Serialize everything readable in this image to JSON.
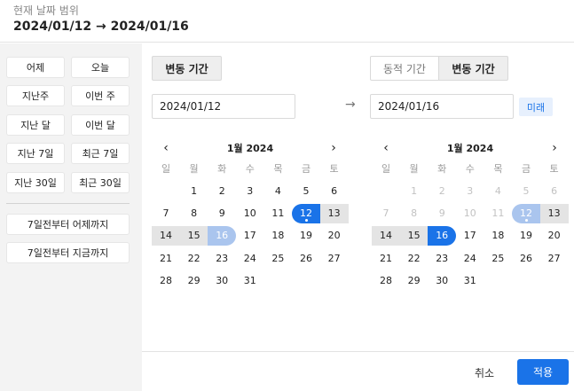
{
  "header": {
    "label": "현재 날짜 범위",
    "range": "2024/01/12 → 2024/01/16"
  },
  "quick": {
    "yesterday": "어제",
    "today": "오늘",
    "last_week": "지난주",
    "this_week": "이번 주",
    "last_month": "지난 달",
    "this_month": "이번 달",
    "last_7": "지난 7일",
    "recent_7": "최근 7일",
    "last_30": "지난 30일",
    "recent_30": "최근 30일",
    "seven_to_yesterday": "7일전부터 어제까지",
    "seven_to_now": "7일전부터 지금까지"
  },
  "start": {
    "tab_label": "변동 기간",
    "date_value": "2024/01/12",
    "month_label": "1월 2024"
  },
  "end": {
    "tab_dynamic": "동적 기간",
    "tab_variable": "변동 기간",
    "date_value": "2024/01/16",
    "future_badge": "미래",
    "month_label": "1월 2024"
  },
  "calendar": {
    "weekdays": [
      "일",
      "월",
      "화",
      "수",
      "목",
      "금",
      "토"
    ],
    "prev_icon": "‹",
    "next_icon": "›",
    "range_arrow": "→"
  },
  "left_cal": {
    "weeks": [
      [
        "",
        "1",
        "2",
        "3",
        "4",
        "5",
        "6"
      ],
      [
        "7",
        "8",
        "9",
        "10",
        "11",
        "12",
        "13"
      ],
      [
        "14",
        "15",
        "16",
        "17",
        "18",
        "19",
        "20"
      ],
      [
        "21",
        "22",
        "23",
        "24",
        "25",
        "26",
        "27"
      ],
      [
        "28",
        "29",
        "30",
        "31",
        "",
        "",
        ""
      ]
    ]
  },
  "right_cal": {
    "weeks": [
      [
        "",
        "1",
        "2",
        "3",
        "4",
        "5",
        "6"
      ],
      [
        "7",
        "8",
        "9",
        "10",
        "11",
        "12",
        "13"
      ],
      [
        "14",
        "15",
        "16",
        "17",
        "18",
        "19",
        "20"
      ],
      [
        "21",
        "22",
        "23",
        "24",
        "25",
        "26",
        "27"
      ],
      [
        "28",
        "29",
        "30",
        "31",
        "",
        "",
        ""
      ]
    ]
  },
  "footer": {
    "cancel": "취소",
    "apply": "적용"
  },
  "colors": {
    "accent": "#1a73e8",
    "accent_light": "#aac5ee",
    "range_fill": "#e4e4e4",
    "future_badge_bg": "#e7f0fd"
  }
}
